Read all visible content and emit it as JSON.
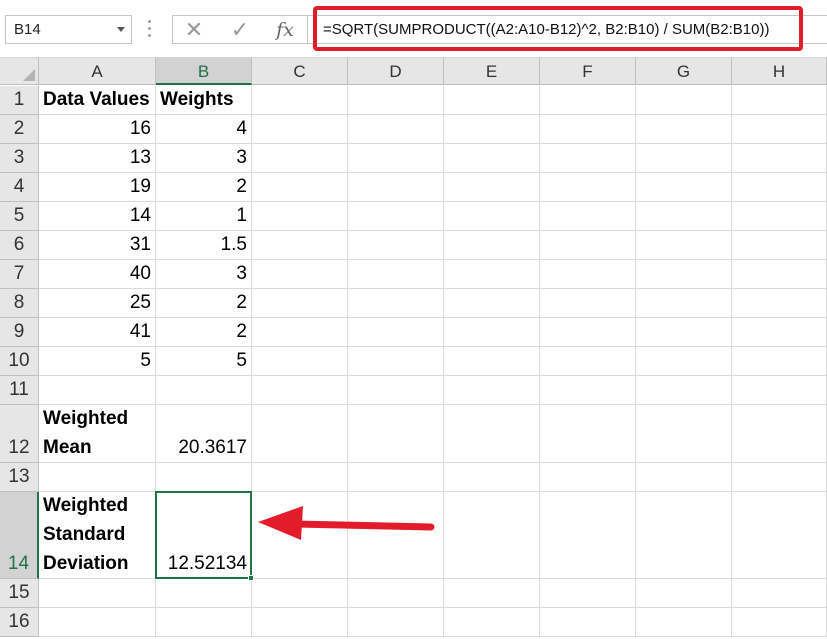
{
  "name_box": {
    "value": "B14"
  },
  "formula_bar": {
    "cancel_symbol": "✕",
    "enter_symbol": "✓",
    "fx_label": "fx",
    "formula": "=SQRT(SUMPRODUCT((A2:A10-B12)^2, B2:B10) / SUM(B2:B10))"
  },
  "columns": [
    "A",
    "B",
    "C",
    "D",
    "E",
    "F",
    "G",
    "H"
  ],
  "rows": [
    "1",
    "2",
    "3",
    "4",
    "5",
    "6",
    "7",
    "8",
    "9",
    "10",
    "11",
    "12",
    "13",
    "14",
    "15",
    "16"
  ],
  "cells": {
    "A1": "Data Values",
    "B1": "Weights",
    "data": [
      {
        "a": "16",
        "b": "4"
      },
      {
        "a": "13",
        "b": "3"
      },
      {
        "a": "19",
        "b": "2"
      },
      {
        "a": "14",
        "b": "1"
      },
      {
        "a": "31",
        "b": "1.5"
      },
      {
        "a": "40",
        "b": "3"
      },
      {
        "a": "25",
        "b": "2"
      },
      {
        "a": "41",
        "b": "2"
      },
      {
        "a": "5",
        "b": "5"
      }
    ],
    "A12": [
      "Weighted",
      "Mean"
    ],
    "B12": "20.3617",
    "A14": [
      "Weighted",
      "Standard",
      "Deviation"
    ],
    "B14": "12.52134"
  },
  "selected_cell": "B14",
  "colors": {
    "accent": "#217346",
    "highlight": "#e21c2a"
  }
}
